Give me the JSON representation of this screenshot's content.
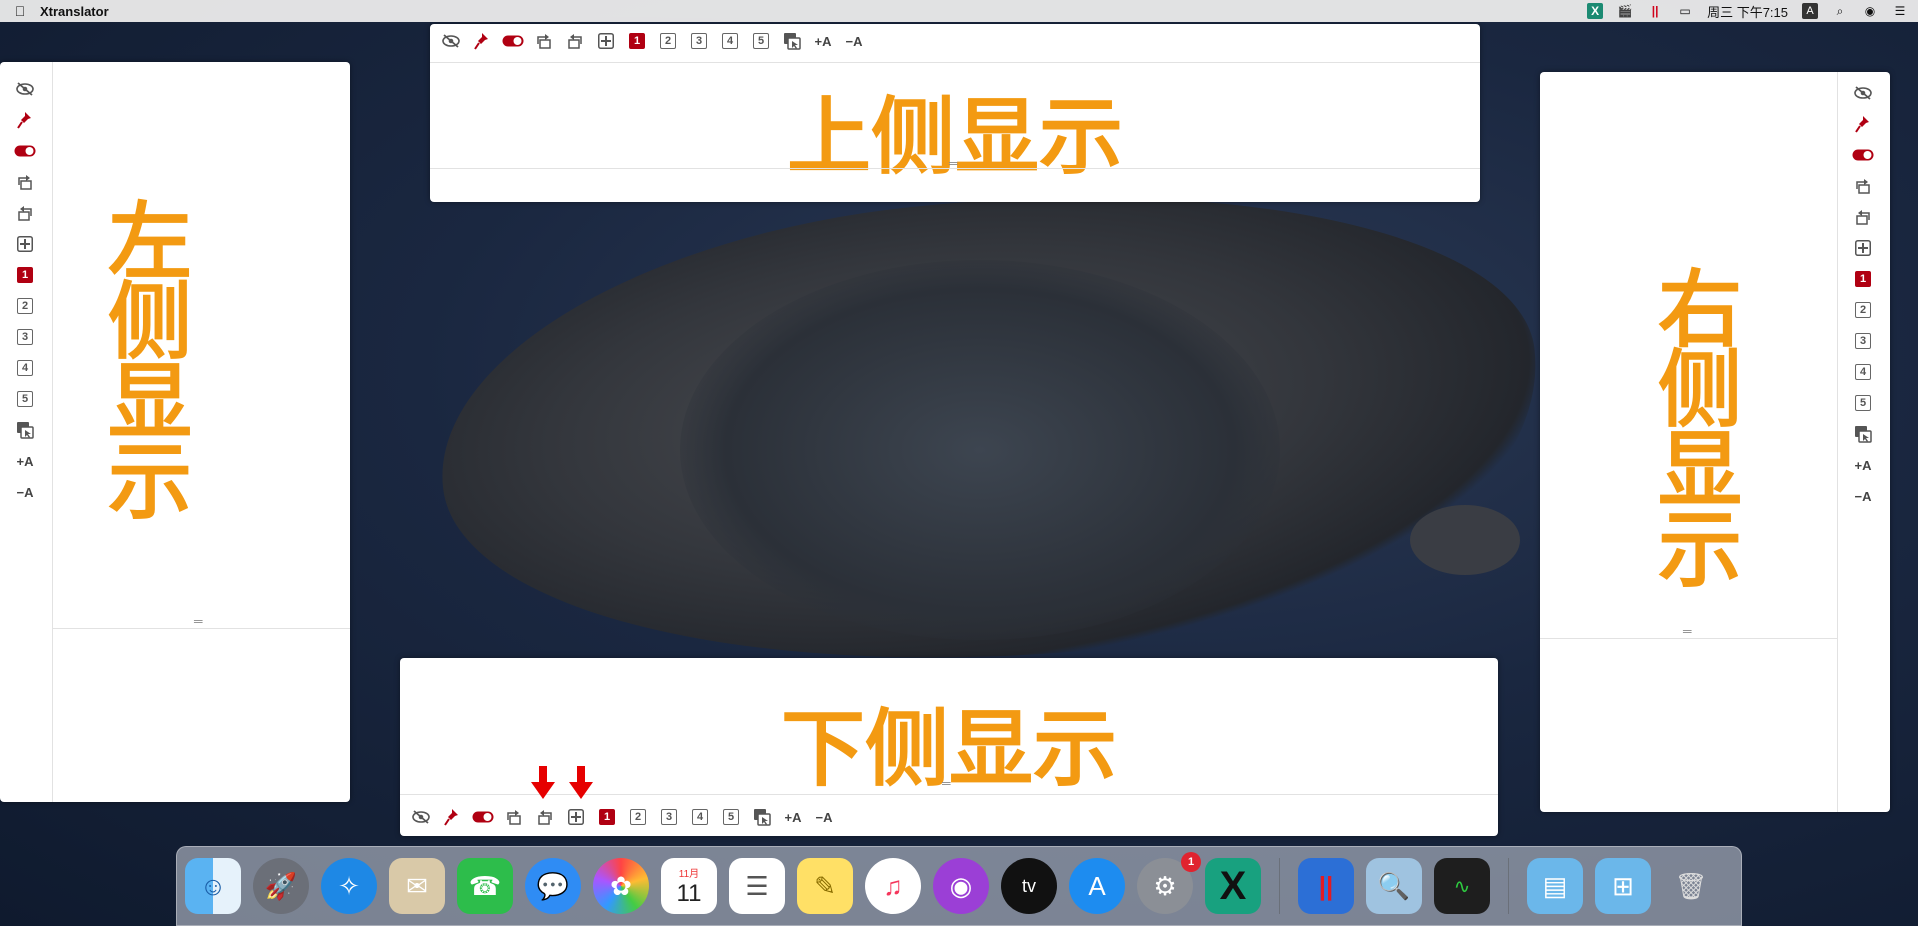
{
  "menubar": {
    "app_name": "Xtranslator",
    "datetime": "周三 下午7:15",
    "input_method": "A",
    "icons": [
      "xtranslator-icon",
      "video-recorder-icon",
      "parallels-icon",
      "display-icon",
      "input-source-icon",
      "spotlight-icon",
      "siri-icon",
      "control-center-icon"
    ]
  },
  "toolbar": {
    "num1": "1",
    "num2": "2",
    "num3": "3",
    "num4": "4",
    "num5": "5",
    "font_up": "+A",
    "font_down": "−A"
  },
  "panels": {
    "top_text": "上侧显示",
    "bottom_text": "下侧显示",
    "left_text": "左侧显示",
    "right_text": "右侧显示",
    "left_chars": [
      "左",
      "侧",
      "显",
      "示"
    ],
    "right_chars": [
      "右",
      "侧",
      "显",
      "示"
    ],
    "grip": "═"
  },
  "dock": {
    "calendar_month": "11月",
    "calendar_day": "11",
    "settings_badge": "1",
    "items": [
      "finder",
      "launchpad",
      "safari",
      "mail",
      "facetime",
      "messages",
      "photos",
      "calendar",
      "reminders",
      "notes",
      "music",
      "podcasts",
      "apple-tv",
      "app-store",
      "system-preferences",
      "xtranslator",
      "parallels",
      "preview",
      "activity-monitor",
      "downloads-folder",
      "applications-folder",
      "trash"
    ],
    "tv_label": "tv",
    "xtranslator_label": "X"
  },
  "colors": {
    "accent_orange": "#f39a12",
    "active_red": "#b00012",
    "arrow_red": "#e60000"
  }
}
